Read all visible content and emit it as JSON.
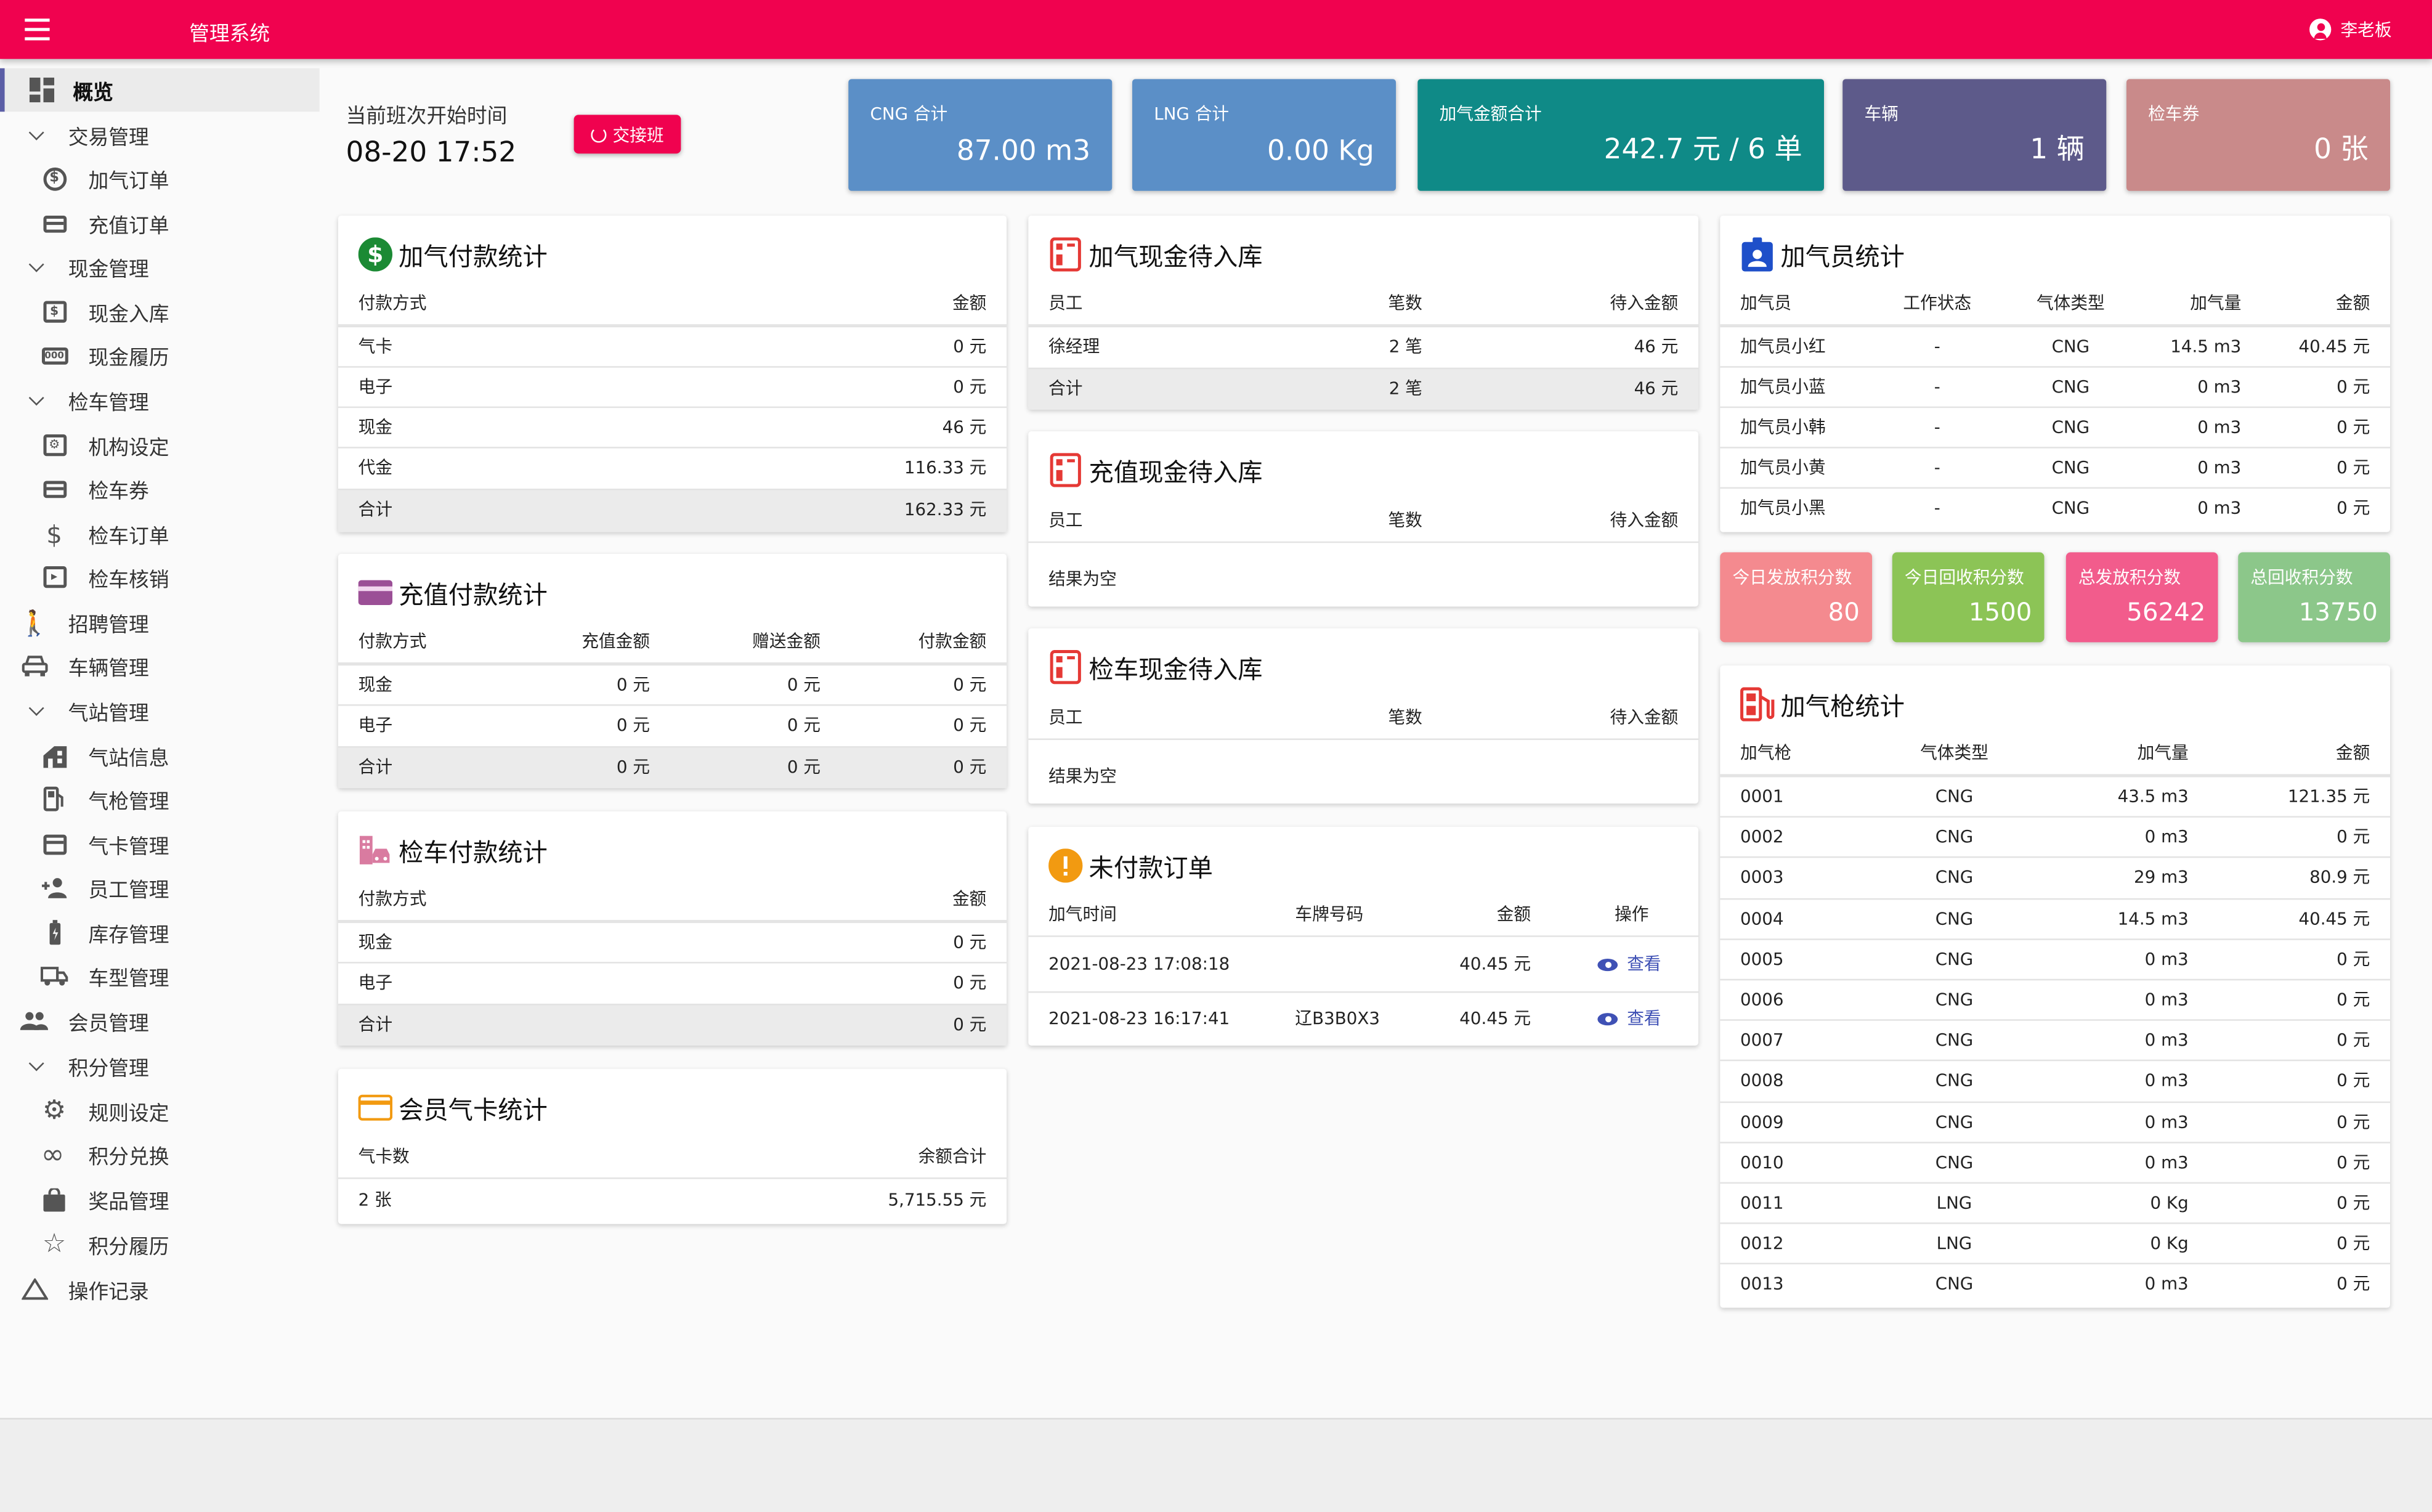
{
  "header": {
    "app_title": "管理系统",
    "user_name": "李老板"
  },
  "sidebar": {
    "items": [
      {
        "label": "概览",
        "icon": "dashboard-icon"
      },
      {
        "label": "交易管理",
        "icon": "chevron-down-icon"
      },
      {
        "label": "加气订单",
        "icon": "dollar-circle-icon"
      },
      {
        "label": "充值订单",
        "icon": "credit-card-icon"
      },
      {
        "label": "现金管理",
        "icon": "chevron-down-icon"
      },
      {
        "label": "现金入库",
        "icon": "cash-box-icon"
      },
      {
        "label": "现金履历",
        "icon": "cash-history-icon"
      },
      {
        "label": "检车管理",
        "icon": "chevron-down-icon"
      },
      {
        "label": "机构设定",
        "icon": "org-settings-icon"
      },
      {
        "label": "检车券",
        "icon": "credit-card-icon"
      },
      {
        "label": "检车订单",
        "icon": "dollar-icon"
      },
      {
        "label": "检车核销",
        "icon": "verify-icon"
      },
      {
        "label": "招聘管理",
        "icon": "person-walk-icon"
      },
      {
        "label": "车辆管理",
        "icon": "car-icon"
      },
      {
        "label": "气站管理",
        "icon": "chevron-down-icon"
      },
      {
        "label": "气站信息",
        "icon": "station-icon"
      },
      {
        "label": "气枪管理",
        "icon": "fuel-pump-icon"
      },
      {
        "label": "气卡管理",
        "icon": "card-icon"
      },
      {
        "label": "员工管理",
        "icon": "person-add-icon"
      },
      {
        "label": "库存管理",
        "icon": "battery-icon"
      },
      {
        "label": "车型管理",
        "icon": "truck-icon"
      },
      {
        "label": "会员管理",
        "icon": "people-icon"
      },
      {
        "label": "积分管理",
        "icon": "chevron-down-icon"
      },
      {
        "label": "规则设定",
        "icon": "gear-icon"
      },
      {
        "label": "积分兑换",
        "icon": "infinity-icon"
      },
      {
        "label": "奖品管理",
        "icon": "shopping-bag-icon"
      },
      {
        "label": "积分履历",
        "icon": "star-icon"
      },
      {
        "label": "操作记录",
        "icon": "warning-triangle-icon"
      }
    ]
  },
  "shift": {
    "label": "当前班次开始时间",
    "time": "08-20 17:52",
    "button": "交接班"
  },
  "tiles": [
    {
      "label": "CNG 合计",
      "value": "87.00 m3",
      "color": "#5b8fc7"
    },
    {
      "label": "LNG 合计",
      "value": "0.00 Kg",
      "color": "#5b8fc7"
    },
    {
      "label": "加气金额合计",
      "value": "242.7 元 / 6 单",
      "color": "#0f8a87"
    },
    {
      "label": "车辆",
      "value": "1 辆",
      "color": "#5d5a8a"
    },
    {
      "label": "检车券",
      "value": "0 张",
      "color": "#c98a8a"
    }
  ],
  "points": [
    {
      "label": "今日发放积分数",
      "value": "80",
      "color": "#f48a8f"
    },
    {
      "label": "今日回收积分数",
      "value": "1500",
      "color": "#8cc456"
    },
    {
      "label": "总发放积分数",
      "value": "56242",
      "color": "#f25c8c"
    },
    {
      "label": "总回收积分数",
      "value": "13750",
      "color": "#8cc78a"
    }
  ],
  "gas_payment": {
    "title": "加气付款统计",
    "headers": [
      "付款方式",
      "金额"
    ],
    "rows": [
      [
        "气卡",
        "0 元"
      ],
      [
        "电子",
        "0 元"
      ],
      [
        "现金",
        "46 元"
      ],
      [
        "代金",
        "116.33 元"
      ]
    ],
    "total": [
      "合计",
      "162.33 元"
    ]
  },
  "recharge_payment": {
    "title": "充值付款统计",
    "headers": [
      "付款方式",
      "充值金额",
      "赠送金额",
      "付款金额"
    ],
    "rows": [
      [
        "现金",
        "0 元",
        "0 元",
        "0 元"
      ],
      [
        "电子",
        "0 元",
        "0 元",
        "0 元"
      ]
    ],
    "total": [
      "合计",
      "0 元",
      "0 元",
      "0 元"
    ]
  },
  "inspection_payment": {
    "title": "检车付款统计",
    "headers": [
      "付款方式",
      "金额"
    ],
    "rows": [
      [
        "现金",
        "0 元"
      ],
      [
        "电子",
        "0 元"
      ]
    ],
    "total": [
      "合计",
      "0 元"
    ]
  },
  "member_card": {
    "title": "会员气卡统计",
    "headers": [
      "气卡数",
      "余额合计"
    ],
    "rows": [
      [
        "2 张",
        "5,715.55 元"
      ]
    ]
  },
  "gas_cash": {
    "title": "加气现金待入库",
    "headers": [
      "员工",
      "笔数",
      "待入金额"
    ],
    "rows": [
      [
        "徐经理",
        "2 笔",
        "46 元"
      ]
    ],
    "total": [
      "合计",
      "2 笔",
      "46 元"
    ]
  },
  "recharge_cash": {
    "title": "充值现金待入库",
    "headers": [
      "员工",
      "笔数",
      "待入金额"
    ],
    "empty": "结果为空"
  },
  "inspection_cash": {
    "title": "检车现金待入库",
    "headers": [
      "员工",
      "笔数",
      "待入金额"
    ],
    "empty": "结果为空"
  },
  "unpaid": {
    "title": "未付款订单",
    "headers": [
      "加气时间",
      "车牌号码",
      "金额",
      "操作"
    ],
    "rows": [
      {
        "time": "2021-08-23 17:08:18",
        "plate": "",
        "amount": "40.45 元",
        "action": "查看"
      },
      {
        "time": "2021-08-23 16:17:41",
        "plate": "辽B3B0X3",
        "amount": "40.45 元",
        "action": "查看"
      }
    ]
  },
  "attendant": {
    "title": "加气员统计",
    "headers": [
      "加气员",
      "工作状态",
      "气体类型",
      "加气量",
      "金额"
    ],
    "rows": [
      [
        "加气员小红",
        "-",
        "CNG",
        "14.5 m3",
        "40.45 元"
      ],
      [
        "加气员小蓝",
        "-",
        "CNG",
        "0 m3",
        "0 元"
      ],
      [
        "加气员小韩",
        "-",
        "CNG",
        "0 m3",
        "0 元"
      ],
      [
        "加气员小黄",
        "-",
        "CNG",
        "0 m3",
        "0 元"
      ],
      [
        "加气员小黑",
        "-",
        "CNG",
        "0 m3",
        "0 元"
      ]
    ]
  },
  "gun": {
    "title": "加气枪统计",
    "headers": [
      "加气枪",
      "气体类型",
      "加气量",
      "金额"
    ],
    "rows": [
      [
        "0001",
        "CNG",
        "43.5 m3",
        "121.35 元"
      ],
      [
        "0002",
        "CNG",
        "0 m3",
        "0 元"
      ],
      [
        "0003",
        "CNG",
        "29 m3",
        "80.9 元"
      ],
      [
        "0004",
        "CNG",
        "14.5 m3",
        "40.45 元"
      ],
      [
        "0005",
        "CNG",
        "0 m3",
        "0 元"
      ],
      [
        "0006",
        "CNG",
        "0 m3",
        "0 元"
      ],
      [
        "0007",
        "CNG",
        "0 m3",
        "0 元"
      ],
      [
        "0008",
        "CNG",
        "0 m3",
        "0 元"
      ],
      [
        "0009",
        "CNG",
        "0 m3",
        "0 元"
      ],
      [
        "0010",
        "CNG",
        "0 m3",
        "0 元"
      ],
      [
        "0011",
        "LNG",
        "0 Kg",
        "0 元"
      ],
      [
        "0012",
        "LNG",
        "0 Kg",
        "0 元"
      ],
      [
        "0013",
        "CNG",
        "0 m3",
        "0 元"
      ]
    ]
  }
}
